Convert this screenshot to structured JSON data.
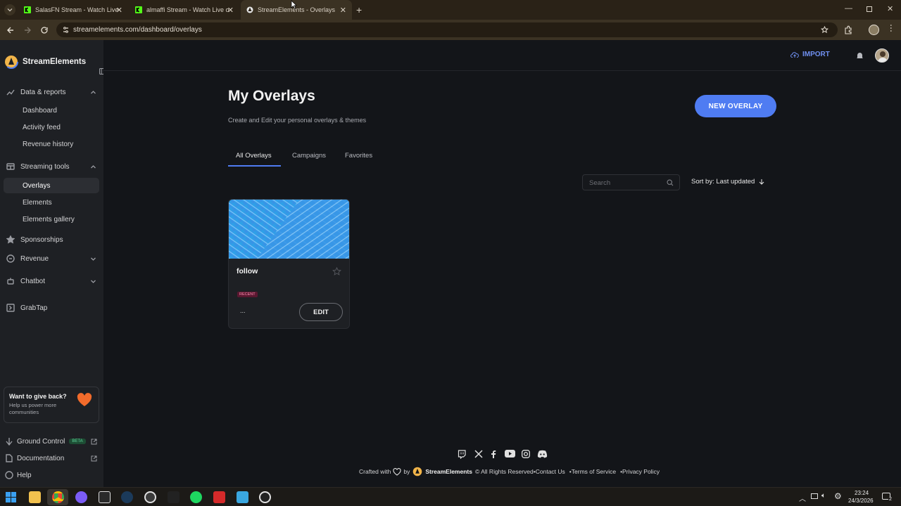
{
  "browser": {
    "tabs": [
      {
        "title": "SalasFN Stream - Watch Live on",
        "active": false
      },
      {
        "title": "almaffi Stream - Watch Live on",
        "active": false
      },
      {
        "title": "StreamElements - Overlays",
        "active": true
      }
    ],
    "url": "streamelements.com/dashboard/overlays"
  },
  "sidebar": {
    "brand": "StreamElements",
    "groups": [
      {
        "label": "Data & reports",
        "items": [
          "Dashboard",
          "Activity feed",
          "Revenue history"
        ]
      },
      {
        "label": "Streaming tools",
        "items": [
          "Overlays",
          "Elements",
          "Elements gallery"
        ]
      }
    ],
    "single_items": [
      "Sponsorships",
      "Revenue",
      "Chatbot",
      "GrabTap"
    ],
    "give_back": {
      "title": "Want to give back?",
      "text": "Help us power more communities"
    },
    "footer": {
      "ground_control": "Ground Control",
      "beta": "BETA",
      "documentation": "Documentation",
      "help": "Help"
    }
  },
  "header": {
    "import": "IMPORT"
  },
  "page": {
    "title": "My Overlays",
    "subtitle": "Create and Edit your personal overlays & themes",
    "new_overlay": "NEW OVERLAY",
    "tabs": [
      "All Overlays",
      "Campaigns",
      "Favorites"
    ],
    "search_placeholder": "Search",
    "sort": "Sort by: Last updated"
  },
  "overlay_card": {
    "name": "follow",
    "badge": "RECENT",
    "menu": "...",
    "edit": "EDIT"
  },
  "footer": {
    "crafted_with": "Crafted with",
    "by": "by",
    "brand": "StreamElements",
    "rights": "© All Rights Reserved",
    "contact": "•Contact Us",
    "terms": "•Terms of Service",
    "privacy": "•Privacy Policy"
  },
  "taskbar": {
    "time": "23:24",
    "date": "24/3/2026",
    "notif_count": "2"
  },
  "colors": {
    "accent": "#4f7cf2",
    "sidebar_bg": "#1e2024",
    "main_bg": "#131519",
    "badge": "#c2185b"
  }
}
